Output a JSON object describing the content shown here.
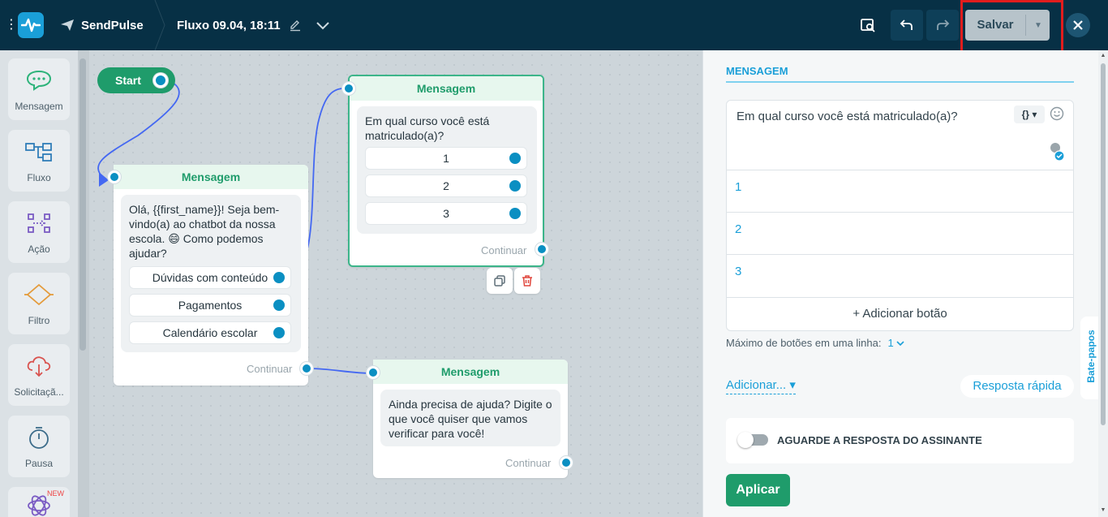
{
  "header": {
    "brand": "SendPulse",
    "flow_name": "Fluxo 09.04, 18:11",
    "save_label": "Salvar"
  },
  "sidebar": {
    "items": [
      {
        "label": "Mensagem",
        "icon": "chat-bubble-icon"
      },
      {
        "label": "Fluxo",
        "icon": "flow-icon"
      },
      {
        "label": "Ação",
        "icon": "action-icon"
      },
      {
        "label": "Filtro",
        "icon": "filter-icon"
      },
      {
        "label": "Solicitaçã...",
        "icon": "cloud-request-icon"
      },
      {
        "label": "Pausa",
        "icon": "timer-icon"
      }
    ],
    "new_badge": "NEW"
  },
  "canvas": {
    "start_label": "Start",
    "nodes": [
      {
        "title": "Mensagem",
        "text": "Olá,  {{first_name}}! Seja bem-vindo(a) ao chatbot da nossa escola. 😄 Como podemos ajudar?",
        "options": [
          "Dúvidas com conteúdo",
          "Pagamentos",
          "Calendário escolar"
        ],
        "continue": "Continuar"
      },
      {
        "title": "Mensagem",
        "text": "Em qual curso você está matriculado(a)?",
        "options": [
          "1",
          "2",
          "3"
        ],
        "continue": "Continuar"
      },
      {
        "title": "Mensagem",
        "text": "Ainda precisa de ajuda? Digite o que você quiser que vamos verificar para você!",
        "options": [],
        "continue": "Continuar"
      }
    ]
  },
  "panel": {
    "title": "MENSAGEM",
    "message": "Em qual curso você está matriculado(a)?",
    "vars_label": "{}",
    "buttons": [
      "1",
      "2",
      "3"
    ],
    "add_button": "+ Adicionar botão",
    "max_label": "Máximo de botões em uma linha:",
    "max_value": "1",
    "add_label": "Adicionar...",
    "quick_reply": "Resposta rápida",
    "await_label": "AGUARDE A RESPOSTA DO ASSINANTE",
    "apply_label": "Aplicar",
    "chat_tab": "Bate-papos"
  },
  "colors": {
    "topbar": "#073045",
    "accent_green": "#1f9c6b",
    "accent_blue": "#1a9fd8",
    "highlight": "#e11d1d"
  }
}
